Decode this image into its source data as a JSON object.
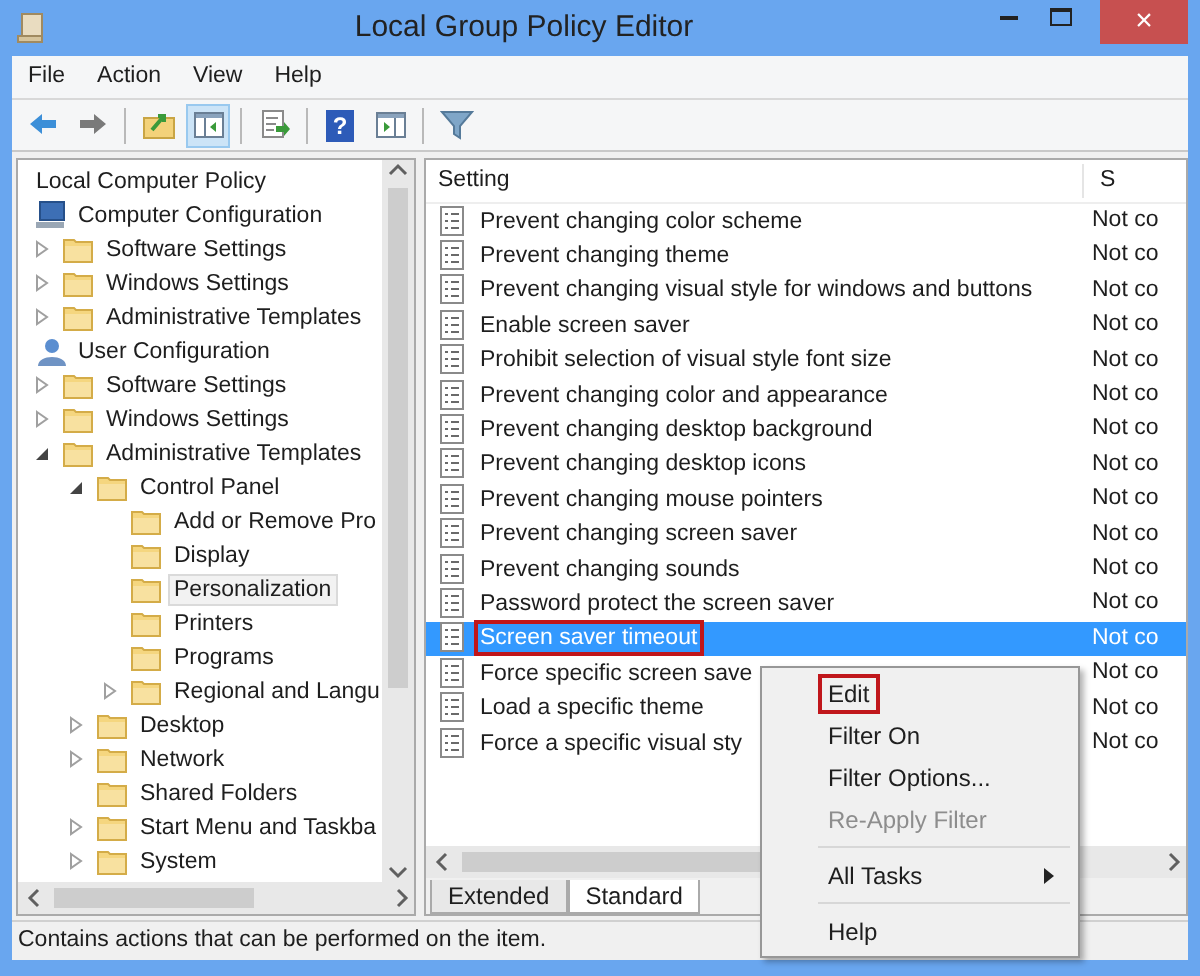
{
  "window": {
    "title": "Local Group Policy Editor",
    "close_label": "×"
  },
  "menu": [
    "File",
    "Action",
    "View",
    "Help"
  ],
  "toolbar": [
    {
      "kind": "back",
      "pressed": false
    },
    {
      "kind": "forward",
      "pressed": false
    },
    {
      "kind": "separator"
    },
    {
      "kind": "up",
      "pressed": false
    },
    {
      "kind": "tree",
      "pressed": true
    },
    {
      "kind": "separator"
    },
    {
      "kind": "export",
      "pressed": false
    },
    {
      "kind": "separator"
    },
    {
      "kind": "help",
      "pressed": false,
      "label": "?"
    },
    {
      "kind": "pane",
      "pressed": false
    },
    {
      "kind": "separator"
    },
    {
      "kind": "filter",
      "pressed": false
    }
  ],
  "tree": {
    "label": "Local Computer Policy",
    "selected": false,
    "children": [
      {
        "label": "Computer Configuration",
        "kind": "computer",
        "selected": false,
        "children": [
          {
            "label": "Software Settings",
            "kind": "folder",
            "selected": false,
            "expanded": false
          },
          {
            "label": "Windows Settings",
            "kind": "folder",
            "selected": false,
            "expanded": false
          },
          {
            "label": "Administrative Templates",
            "kind": "folder",
            "selected": false,
            "expanded": false
          }
        ]
      },
      {
        "label": "User Configuration",
        "kind": "user",
        "selected": false,
        "children": [
          {
            "label": "Software Settings",
            "kind": "folder",
            "selected": false,
            "expanded": false
          },
          {
            "label": "Windows Settings",
            "kind": "folder",
            "selected": false,
            "expanded": false
          },
          {
            "label": "Administrative Templates",
            "kind": "folder",
            "selected": false,
            "expanded": true,
            "children": [
              {
                "label": "Control Panel",
                "kind": "folder",
                "selected": false,
                "expanded": true,
                "children": [
                  {
                    "label": "Add or Remove Pro",
                    "kind": "folder",
                    "selected": false
                  },
                  {
                    "label": "Display",
                    "kind": "folder",
                    "selected": false
                  },
                  {
                    "label": "Personalization",
                    "kind": "folder",
                    "selected": true
                  },
                  {
                    "label": "Printers",
                    "kind": "folder",
                    "selected": false
                  },
                  {
                    "label": "Programs",
                    "kind": "folder",
                    "selected": false
                  },
                  {
                    "label": "Regional and Langu",
                    "kind": "folder",
                    "selected": false,
                    "expanded": false
                  }
                ]
              },
              {
                "label": "Desktop",
                "kind": "folder",
                "selected": false,
                "expanded": false
              },
              {
                "label": "Network",
                "kind": "folder",
                "selected": false,
                "expanded": false
              },
              {
                "label": "Shared Folders",
                "kind": "folder",
                "selected": false
              },
              {
                "label": "Start Menu and Taskba",
                "kind": "folder",
                "selected": false,
                "expanded": false
              },
              {
                "label": "System",
                "kind": "folder",
                "selected": false,
                "expanded": false
              }
            ]
          }
        ]
      }
    ]
  },
  "list": {
    "columns": [
      "Setting",
      "S"
    ],
    "rows": [
      {
        "name": "Prevent changing color scheme",
        "state": "Not co",
        "selected": false,
        "highlighted": false
      },
      {
        "name": "Prevent changing theme",
        "state": "Not co",
        "selected": false,
        "highlighted": false
      },
      {
        "name": "Prevent changing visual style for windows and buttons",
        "state": "Not co",
        "selected": false,
        "highlighted": false
      },
      {
        "name": "Enable screen saver",
        "state": "Not co",
        "selected": false,
        "highlighted": false
      },
      {
        "name": "Prohibit selection of visual style font size",
        "state": "Not co",
        "selected": false,
        "highlighted": false
      },
      {
        "name": "Prevent changing color and appearance",
        "state": "Not co",
        "selected": false,
        "highlighted": false
      },
      {
        "name": "Prevent changing desktop background",
        "state": "Not co",
        "selected": false,
        "highlighted": false
      },
      {
        "name": "Prevent changing desktop icons",
        "state": "Not co",
        "selected": false,
        "highlighted": false
      },
      {
        "name": "Prevent changing mouse pointers",
        "state": "Not co",
        "selected": false,
        "highlighted": false
      },
      {
        "name": "Prevent changing screen saver",
        "state": "Not co",
        "selected": false,
        "highlighted": false
      },
      {
        "name": "Prevent changing sounds",
        "state": "Not co",
        "selected": false,
        "highlighted": false
      },
      {
        "name": "Password protect the screen saver",
        "state": "Not co",
        "selected": false,
        "highlighted": false
      },
      {
        "name": "Screen saver timeout",
        "state": "Not co",
        "selected": true,
        "highlighted": true
      },
      {
        "name": "Force specific screen save",
        "state": "Not co",
        "selected": false,
        "highlighted": false
      },
      {
        "name": "Load a specific theme",
        "state": "Not co",
        "selected": false,
        "highlighted": false
      },
      {
        "name": "Force a specific visual sty",
        "state": "Not co",
        "selected": false,
        "highlighted": false
      }
    ]
  },
  "tabs": [
    {
      "label": "Extended",
      "selected": false
    },
    {
      "label": "Standard",
      "selected": true
    }
  ],
  "context_menu": [
    {
      "kind": "item",
      "label": "Edit",
      "disabled": false,
      "highlighted": true
    },
    {
      "kind": "item",
      "label": "Filter On",
      "disabled": false,
      "highlighted": false
    },
    {
      "kind": "item",
      "label": "Filter Options...",
      "disabled": false,
      "highlighted": false
    },
    {
      "kind": "item",
      "label": "Re-Apply Filter",
      "disabled": true,
      "highlighted": false
    },
    {
      "kind": "separator"
    },
    {
      "kind": "submenu",
      "label": "All Tasks",
      "disabled": false,
      "highlighted": false
    },
    {
      "kind": "separator"
    },
    {
      "kind": "item",
      "label": "Help",
      "disabled": false,
      "highlighted": false
    }
  ],
  "status_bar": "Contains actions that can be performed on the item."
}
